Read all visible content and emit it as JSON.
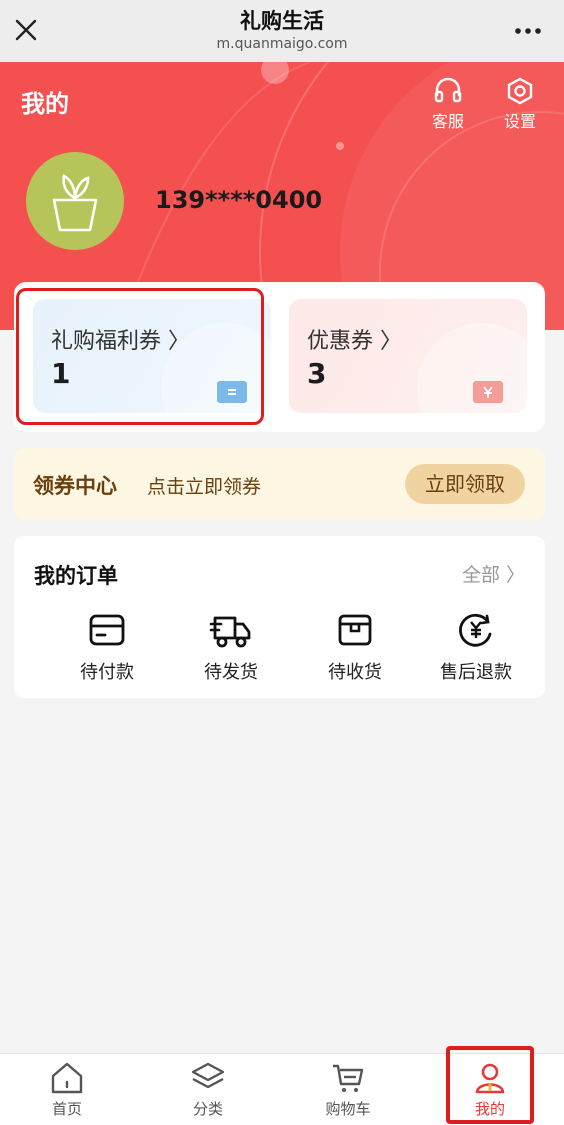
{
  "browser": {
    "title": "礼购生活",
    "url": "m.quanmaigo.com",
    "close_icon": "close-icon",
    "more_icon": "more-icon"
  },
  "header": {
    "title": "我的",
    "service_label": "客服",
    "settings_label": "设置",
    "phone": "139****0400",
    "bg_color": "#f4504f"
  },
  "coupons": {
    "gift": {
      "label": "礼购福利券 〉",
      "count": "1"
    },
    "discount": {
      "label": "优惠券 〉",
      "count": "3"
    }
  },
  "voucher_center": {
    "title": "领券中心",
    "subtitle": "点击立即领券",
    "button": "立即领取"
  },
  "orders": {
    "title": "我的订单",
    "all": "全部 〉",
    "items": [
      {
        "label": "待付款",
        "icon": "card-icon"
      },
      {
        "label": "待发货",
        "icon": "truck-icon"
      },
      {
        "label": "待收货",
        "icon": "box-icon"
      },
      {
        "label": "售后退款",
        "icon": "refund-icon"
      }
    ]
  },
  "tabs": [
    {
      "label": "首页",
      "icon": "home-icon"
    },
    {
      "label": "分类",
      "icon": "layers-icon"
    },
    {
      "label": "购物车",
      "icon": "cart-icon"
    },
    {
      "label": "我的",
      "icon": "user-icon",
      "active": true
    }
  ]
}
